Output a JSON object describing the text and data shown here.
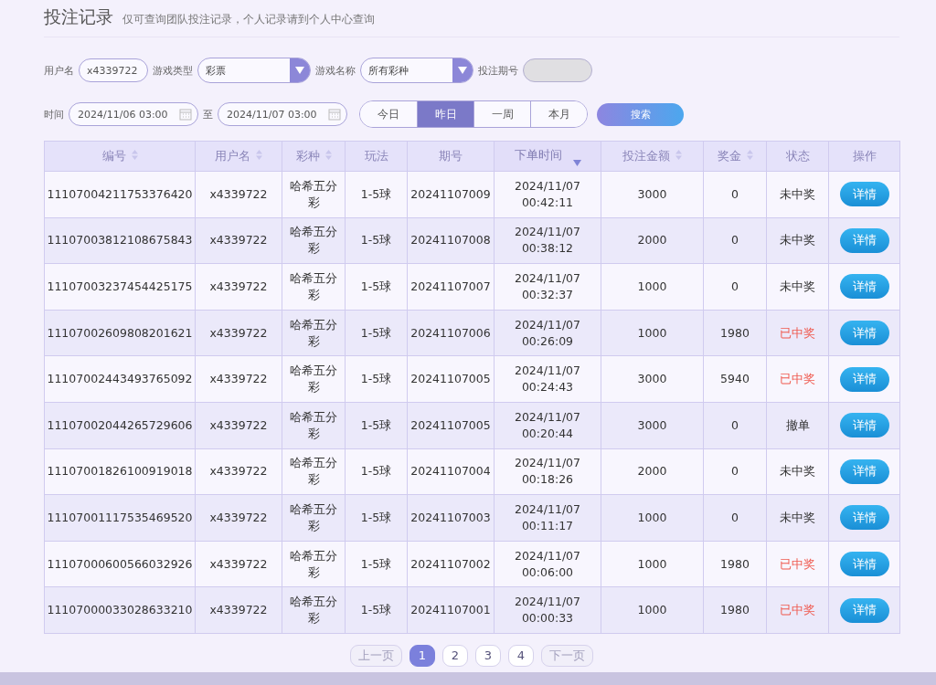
{
  "page": {
    "title": "投注记录",
    "subtitle": "仅可查询团队投注记录，个人记录请到个人中心查询"
  },
  "filters": {
    "username_label": "用户名",
    "username_value": "x4339722",
    "game_type_label": "游戏类型",
    "game_type_value": "彩票",
    "game_name_label": "游戏名称",
    "game_name_value": "所有彩种",
    "period_label": "投注期号",
    "time_label": "时间",
    "time_from": "2024/11/06 03:00",
    "to_label": "至",
    "time_to": "2024/11/07 03:00",
    "search_button": "搜索"
  },
  "range_tabs": [
    {
      "label": "今日",
      "selected": false
    },
    {
      "label": "昨日",
      "selected": true
    },
    {
      "label": "一周",
      "selected": false
    },
    {
      "label": "本月",
      "selected": false
    }
  ],
  "table": {
    "columns": [
      {
        "label": "编号",
        "sortable": true,
        "sorted": false
      },
      {
        "label": "用户名",
        "sortable": true,
        "sorted": false
      },
      {
        "label": "彩种",
        "sortable": true,
        "sorted": false
      },
      {
        "label": "玩法",
        "sortable": false
      },
      {
        "label": "期号",
        "sortable": false
      },
      {
        "label": "下单时间",
        "sortable": true,
        "sorted": true
      },
      {
        "label": "投注金额",
        "sortable": true,
        "sorted": false
      },
      {
        "label": "奖金",
        "sortable": true,
        "sorted": false
      },
      {
        "label": "状态",
        "sortable": false
      },
      {
        "label": "操作",
        "sortable": false
      }
    ],
    "rows": [
      {
        "id": "11107004211753376420",
        "user": "x4339722",
        "lottery": "哈希五分彩",
        "play": "1-5球",
        "period": "20241107009",
        "date": "2024/11/07",
        "time": "00:42:11",
        "amount": "3000",
        "prize": "0",
        "status": "未中奖",
        "won": false,
        "action": "详情"
      },
      {
        "id": "11107003812108675843",
        "user": "x4339722",
        "lottery": "哈希五分彩",
        "play": "1-5球",
        "period": "20241107008",
        "date": "2024/11/07",
        "time": "00:38:12",
        "amount": "2000",
        "prize": "0",
        "status": "未中奖",
        "won": false,
        "action": "详情"
      },
      {
        "id": "11107003237454425175",
        "user": "x4339722",
        "lottery": "哈希五分彩",
        "play": "1-5球",
        "period": "20241107007",
        "date": "2024/11/07",
        "time": "00:32:37",
        "amount": "1000",
        "prize": "0",
        "status": "未中奖",
        "won": false,
        "action": "详情"
      },
      {
        "id": "11107002609808201621",
        "user": "x4339722",
        "lottery": "哈希五分彩",
        "play": "1-5球",
        "period": "20241107006",
        "date": "2024/11/07",
        "time": "00:26:09",
        "amount": "1000",
        "prize": "1980",
        "status": "已中奖",
        "won": true,
        "action": "详情"
      },
      {
        "id": "11107002443493765092",
        "user": "x4339722",
        "lottery": "哈希五分彩",
        "play": "1-5球",
        "period": "20241107005",
        "date": "2024/11/07",
        "time": "00:24:43",
        "amount": "3000",
        "prize": "5940",
        "status": "已中奖",
        "won": true,
        "action": "详情"
      },
      {
        "id": "11107002044265729606",
        "user": "x4339722",
        "lottery": "哈希五分彩",
        "play": "1-5球",
        "period": "20241107005",
        "date": "2024/11/07",
        "time": "00:20:44",
        "amount": "3000",
        "prize": "0",
        "status": "撤单",
        "won": false,
        "action": "详情"
      },
      {
        "id": "11107001826100919018",
        "user": "x4339722",
        "lottery": "哈希五分彩",
        "play": "1-5球",
        "period": "20241107004",
        "date": "2024/11/07",
        "time": "00:18:26",
        "amount": "2000",
        "prize": "0",
        "status": "未中奖",
        "won": false,
        "action": "详情"
      },
      {
        "id": "11107001117535469520",
        "user": "x4339722",
        "lottery": "哈希五分彩",
        "play": "1-5球",
        "period": "20241107003",
        "date": "2024/11/07",
        "time": "00:11:17",
        "amount": "1000",
        "prize": "0",
        "status": "未中奖",
        "won": false,
        "action": "详情"
      },
      {
        "id": "11107000600566032926",
        "user": "x4339722",
        "lottery": "哈希五分彩",
        "play": "1-5球",
        "period": "20241107002",
        "date": "2024/11/07",
        "time": "00:06:00",
        "amount": "1000",
        "prize": "1980",
        "status": "已中奖",
        "won": true,
        "action": "详情"
      },
      {
        "id": "11107000033028633210",
        "user": "x4339722",
        "lottery": "哈希五分彩",
        "play": "1-5球",
        "period": "20241107001",
        "date": "2024/11/07",
        "time": "00:00:33",
        "amount": "1000",
        "prize": "1980",
        "status": "已中奖",
        "won": true,
        "action": "详情"
      }
    ]
  },
  "pagination": {
    "prev": {
      "label": "上一页",
      "disabled": true
    },
    "pages": [
      {
        "label": "1",
        "selected": true
      },
      {
        "label": "2",
        "selected": false
      },
      {
        "label": "3",
        "selected": false
      },
      {
        "label": "4",
        "selected": false
      }
    ],
    "next": {
      "label": "下一页",
      "disabled": true
    }
  }
}
